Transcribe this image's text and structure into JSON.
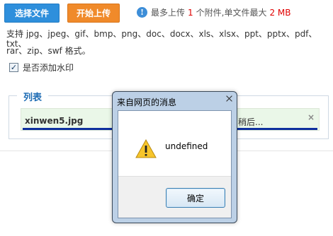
{
  "toolbar": {
    "select_label": "选择文件",
    "upload_label": "开始上传"
  },
  "info": {
    "prefix": "最多上传",
    "max_files": "1",
    "mid": "个附件,单文件最大",
    "max_size": "2 MB"
  },
  "types": {
    "line1": "支持 jpg、jpeg、gif、bmp、png、doc、docx、xls、xlsx、ppt、pptx、pdf、txt、",
    "line2": "rar、zip、swf 格式。"
  },
  "watermark": {
    "checked": "✓",
    "label": "是否添加水印"
  },
  "list": {
    "legend": "列表",
    "file_name": "xinwen5.jpg",
    "status": "稍后...",
    "close": "×",
    "progress": 1.0
  },
  "dialog": {
    "title": "来自网页的消息",
    "message": "undefined",
    "ok_label": "确定"
  },
  "icons": {
    "info": "info-icon",
    "warning": "warning-icon",
    "close": "close-icon"
  },
  "colors": {
    "select_button": "#2e8fdc",
    "upload_button": "#f08a2a",
    "accent_red": "#e00000",
    "legend_blue": "#1e6cb4",
    "progress": "#0d2f9e"
  }
}
